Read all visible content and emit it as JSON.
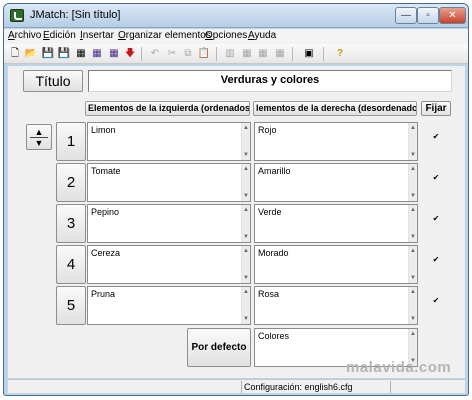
{
  "window": {
    "title": "JMatch: [Sin título]",
    "minimize_glyph": "—",
    "maximize_glyph": "▫",
    "close_glyph": "✕"
  },
  "menu": [
    "Archivo",
    "Edición",
    "Insertar",
    "Organizar elementos",
    "Opciones",
    "Ayuda"
  ],
  "toolbar": {
    "new": "🗋",
    "open": "📂",
    "save": "💾",
    "save_as": "💾",
    "grid": "▦",
    "grid_web": "▦",
    "grid_alt": "▦",
    "export": "🡇",
    "undo": "↶",
    "cut": "✂",
    "copy": "⧉",
    "paste": "📋",
    "tb2a": "▥",
    "tb2b": "▦",
    "tb2c": "▦",
    "tb2d": "▦",
    "tb3": "▣",
    "help": "?"
  },
  "form": {
    "title_button": "Título",
    "title_value": "Verduras y colores",
    "col_left": "Elementos de la izquierda (ordenados)",
    "col_right": "lementos de la derecha (desordenados)",
    "fix_label": "Fijar",
    "rows": [
      {
        "number": "1",
        "left": "Limon",
        "right": "Rojo",
        "fixed": "✔"
      },
      {
        "number": "2",
        "left": "Tomate",
        "right": "Amarillo",
        "fixed": "✔"
      },
      {
        "number": "3",
        "left": "Pepino",
        "right": "Verde",
        "fixed": "✔"
      },
      {
        "number": "4",
        "left": "Cereza",
        "right": "Morado",
        "fixed": "✔"
      },
      {
        "number": "5",
        "left": "Pruna",
        "right": "Rosa",
        "fixed": "✔"
      }
    ],
    "default_button": "Por defecto",
    "default_value": "Colores",
    "scroll_up": "▲",
    "scroll_down": "▼",
    "row_up": "▲",
    "row_down": "▼"
  },
  "status": {
    "config": "Configuración: english6.cfg"
  },
  "watermark": "malavida.com"
}
